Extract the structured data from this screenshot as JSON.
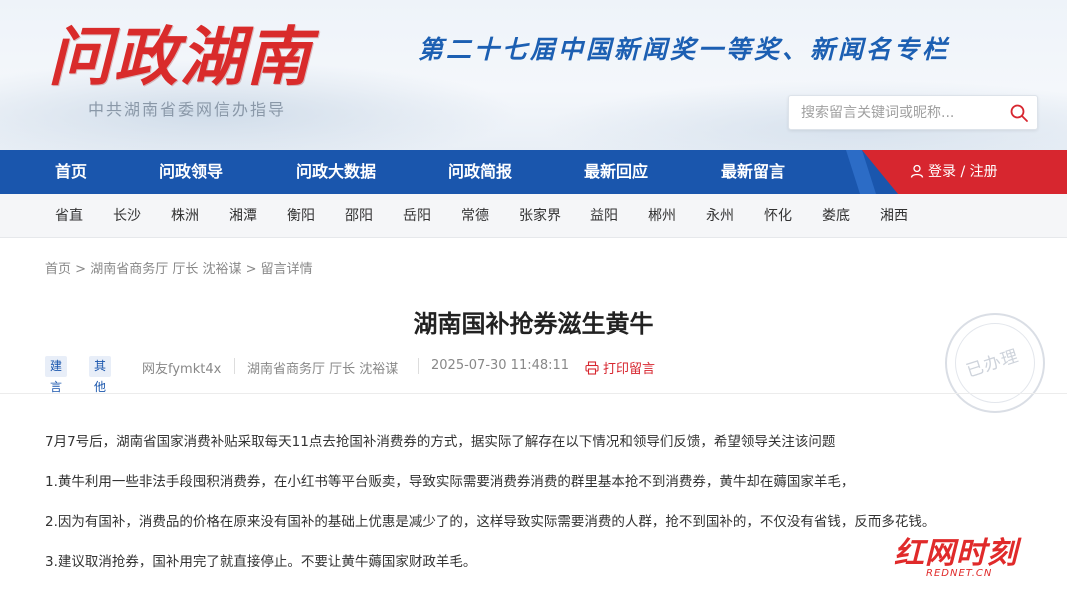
{
  "header": {
    "logo": "问政湖南",
    "subtitle": "中共湖南省委网信办指导",
    "slogan": "第二十七届中国新闻奖一等奖、新闻名专栏",
    "search_placeholder": "搜索留言关键词或昵称..."
  },
  "nav": {
    "items": [
      "首页",
      "问政领导",
      "问政大数据",
      "问政简报",
      "最新回应",
      "最新留言"
    ],
    "login": "登录 / 注册"
  },
  "cities": [
    "省直",
    "长沙",
    "株洲",
    "湘潭",
    "衡阳",
    "邵阳",
    "岳阳",
    "常德",
    "张家界",
    "益阳",
    "郴州",
    "永州",
    "怀化",
    "娄底",
    "湘西"
  ],
  "breadcrumb": [
    "首页",
    ">",
    "湖南省商务厅 厅长 沈裕谋",
    ">",
    "留言详情"
  ],
  "post": {
    "title": "湖南国补抢券滋生黄牛",
    "tags": [
      "建言",
      "其他"
    ],
    "author": "网友fymkt4x",
    "target": "湖南省商务厅 厅长 沈裕谋",
    "time": "2025-07-30 11:48:11",
    "print": "打印留言",
    "stamp": "已办理",
    "paragraphs": [
      "7月7号后，湖南省国家消费补贴采取每天11点去抢国补消费券的方式，据实际了解存在以下情况和领导们反馈，希望领导关注该问题",
      "1.黄牛利用一些非法手段囤积消费券，在小红书等平台贩卖，导致实际需要消费券消费的群里基本抢不到消费券，黄牛却在薅国家羊毛，",
      "2.因为有国补，消费品的价格在原来没有国补的基础上优惠是减少了的，这样导致实际需要消费的人群，抢不到国补的，不仅没有省钱，反而多花钱。",
      "3.建议取消抢券，国补用完了就直接停止。不要让黄牛薅国家财政羊毛。"
    ]
  },
  "watermark": {
    "text": "红网时刻",
    "sub": "REDNET.CN"
  },
  "colors": {
    "nav_blue": "#1a56ad",
    "accent_red": "#d7262f"
  }
}
